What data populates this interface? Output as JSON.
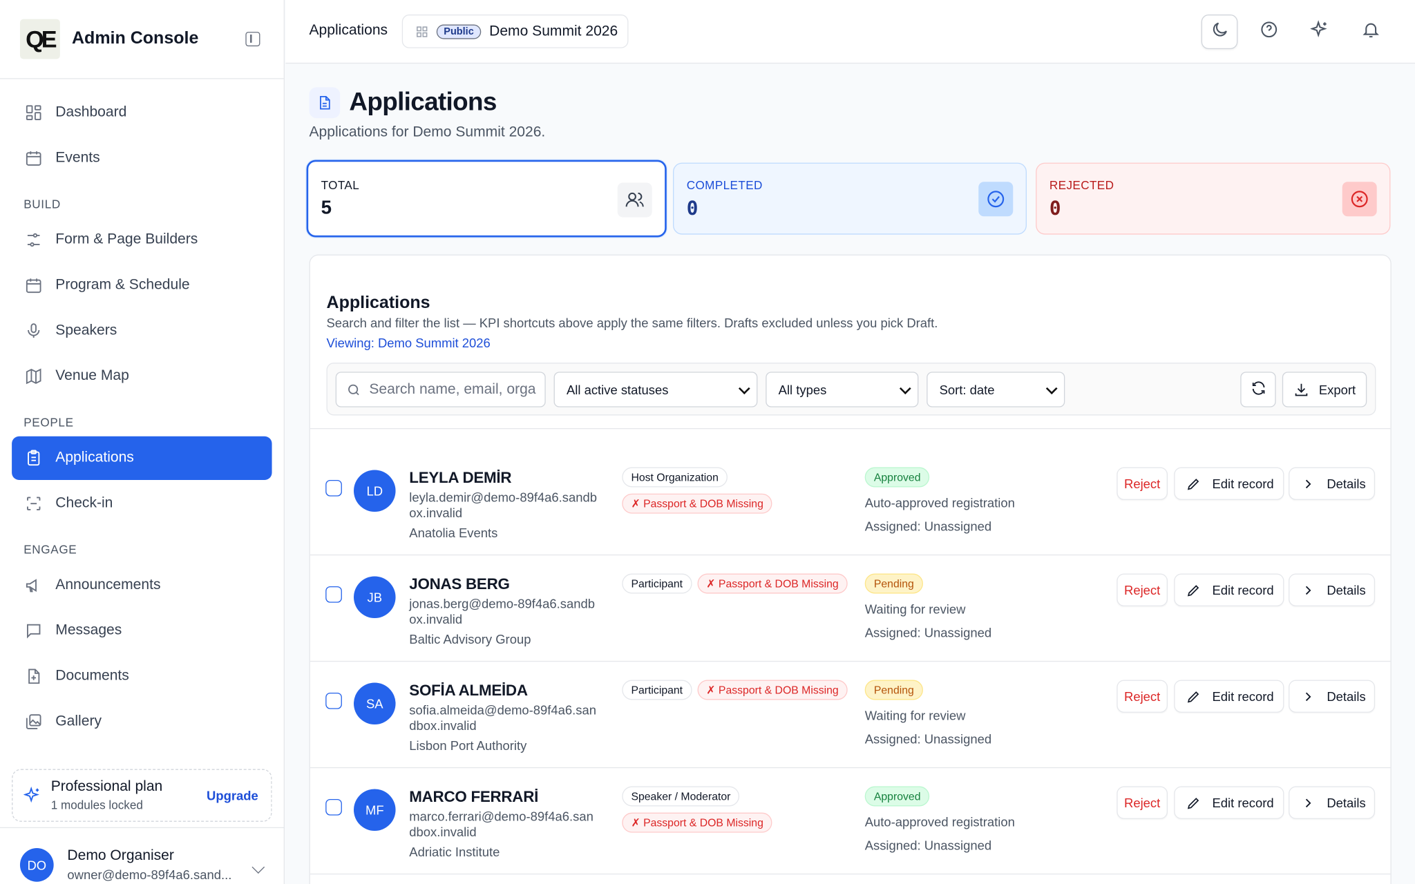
{
  "app": {
    "logo_text": "QE",
    "title": "Admin Console"
  },
  "sidebar": {
    "items": [
      {
        "label": "Dashboard",
        "icon": "dashboard-icon"
      },
      {
        "label": "Events",
        "icon": "calendar-icon"
      }
    ],
    "sections": [
      {
        "label": "BUILD",
        "items": [
          "Form & Page Builders",
          "Program & Schedule",
          "Speakers",
          "Venue Map"
        ]
      },
      {
        "label": "PEOPLE",
        "items": [
          "Applications",
          "Check-in"
        ]
      },
      {
        "label": "ENGAGE",
        "items": [
          "Announcements",
          "Messages",
          "Documents",
          "Gallery"
        ]
      }
    ],
    "active": "Applications",
    "plan": {
      "title": "Professional plan",
      "subtitle": "1 modules locked",
      "upgrade": "Upgrade"
    },
    "user": {
      "initials": "DO",
      "name": "Demo Organiser",
      "email": "owner@demo-89f4a6.sand..."
    }
  },
  "topbar": {
    "breadcrumb": "Applications",
    "badge": "Public",
    "event": "Demo Summit 2026"
  },
  "page": {
    "title": "Applications",
    "subtitle": "Applications for Demo Summit 2026."
  },
  "kpis": {
    "total": {
      "label": "TOTAL",
      "value": "5"
    },
    "completed": {
      "label": "COMPLETED",
      "value": "0"
    },
    "rejected": {
      "label": "REJECTED",
      "value": "0"
    }
  },
  "list": {
    "title": "Applications",
    "subtitle": "Search and filter the list — KPI shortcuts above apply the same filters. Drafts excluded unless you pick Draft.",
    "viewing": "Viewing: Demo Summit 2026",
    "search_placeholder": "Search name, email, orga",
    "status_filter": "All active statuses",
    "type_filter": "All types",
    "sort": "Sort: date",
    "export": "Export",
    "actions": {
      "reject": "Reject",
      "edit": "Edit record",
      "details": "Details"
    }
  },
  "rows": [
    {
      "initials": "LD",
      "name": "LEYLA DEMİR",
      "email": "leyla.demir@demo-89f4a6.sandbox.invalid",
      "org": "Anatolia Events",
      "tags": [
        "Host Organization",
        "✗ Passport & DOB Missing"
      ],
      "status": "Approved",
      "note": "Auto-approved registration",
      "assigned": "Assigned: Unassigned"
    },
    {
      "initials": "JB",
      "name": "JONAS BERG",
      "email": "jonas.berg@demo-89f4a6.sandbox.invalid",
      "org": "Baltic Advisory Group",
      "tags": [
        "Participant",
        "✗ Passport & DOB Missing"
      ],
      "status": "Pending",
      "note": "Waiting for review",
      "assigned": "Assigned: Unassigned"
    },
    {
      "initials": "SA",
      "name": "SOFİA ALMEİDA",
      "email": "sofia.almeida@demo-89f4a6.sandbox.invalid",
      "org": "Lisbon Port Authority",
      "tags": [
        "Participant",
        "✗ Passport & DOB Missing"
      ],
      "status": "Pending",
      "note": "Waiting for review",
      "assigned": "Assigned: Unassigned"
    },
    {
      "initials": "MF",
      "name": "MARCO FERRARİ",
      "email": "marco.ferrari@demo-89f4a6.sandbox.invalid",
      "org": "Adriatic Institute",
      "tags": [
        "Speaker / Moderator",
        "✗ Passport & DOB Missing"
      ],
      "status": "Approved",
      "note": "Auto-approved registration",
      "assigned": "Assigned: Unassigned"
    }
  ],
  "colors": {
    "accent": "#2563eb",
    "approved": "#15803d",
    "pending": "#b45309",
    "danger": "#dc2626"
  }
}
